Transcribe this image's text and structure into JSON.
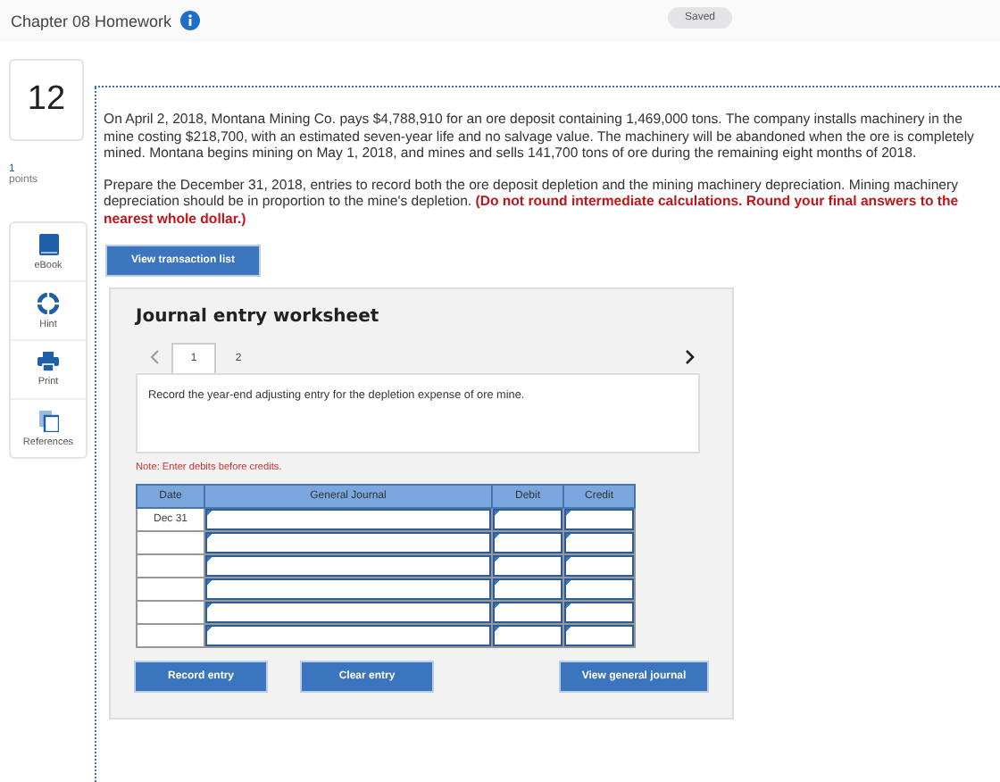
{
  "header": {
    "title": "Chapter 08 Homework",
    "status": "Saved"
  },
  "question": {
    "number": "12",
    "points": "1",
    "points_label": "points"
  },
  "tools": [
    {
      "kind": "book",
      "label": "eBook"
    },
    {
      "kind": "lifebuoy",
      "label": "Hint"
    },
    {
      "kind": "printer",
      "label": "Print"
    },
    {
      "kind": "pages",
      "label": "References"
    }
  ],
  "paragraphs": [
    "On April 2, 2018, Montana Mining Co. pays $4,788,910 for an ore deposit containing 1,469,000 tons. The company installs machinery in the mine costing $218,700, with an estimated seven-year life and no salvage value. The machinery will be abandoned when the ore is completely mined. Montana begins mining on May 1, 2018, and mines and sells 141,700 tons of ore during the remaining eight months of 2018.",
    "Prepare the December 31, 2018, entries to record both the ore deposit depletion and the mining machinery depreciation. Mining machinery depreciation should be in proportion to the mine's depletion. **(Do not round intermediate calculations. Round your final answers to the nearest whole dollar.)**"
  ],
  "transaction_button": "View transaction list",
  "worksheet": {
    "title": "Journal entry worksheet",
    "tabs": [
      {
        "label": "1",
        "selected": true
      },
      {
        "label": "2",
        "selected": false
      }
    ],
    "instruction": "Record the year-end adjusting entry for the depletion expense of ore mine.",
    "note": "Note: Enter debits before credits.",
    "table": {
      "columns": [
        "Date",
        "General Journal",
        "Debit",
        "Credit"
      ],
      "rows": [
        {
          "date": "Dec 31"
        },
        {},
        {},
        {},
        {},
        {}
      ]
    },
    "buttons": [
      "Record entry",
      "Clear entry",
      "View general journal"
    ]
  }
}
